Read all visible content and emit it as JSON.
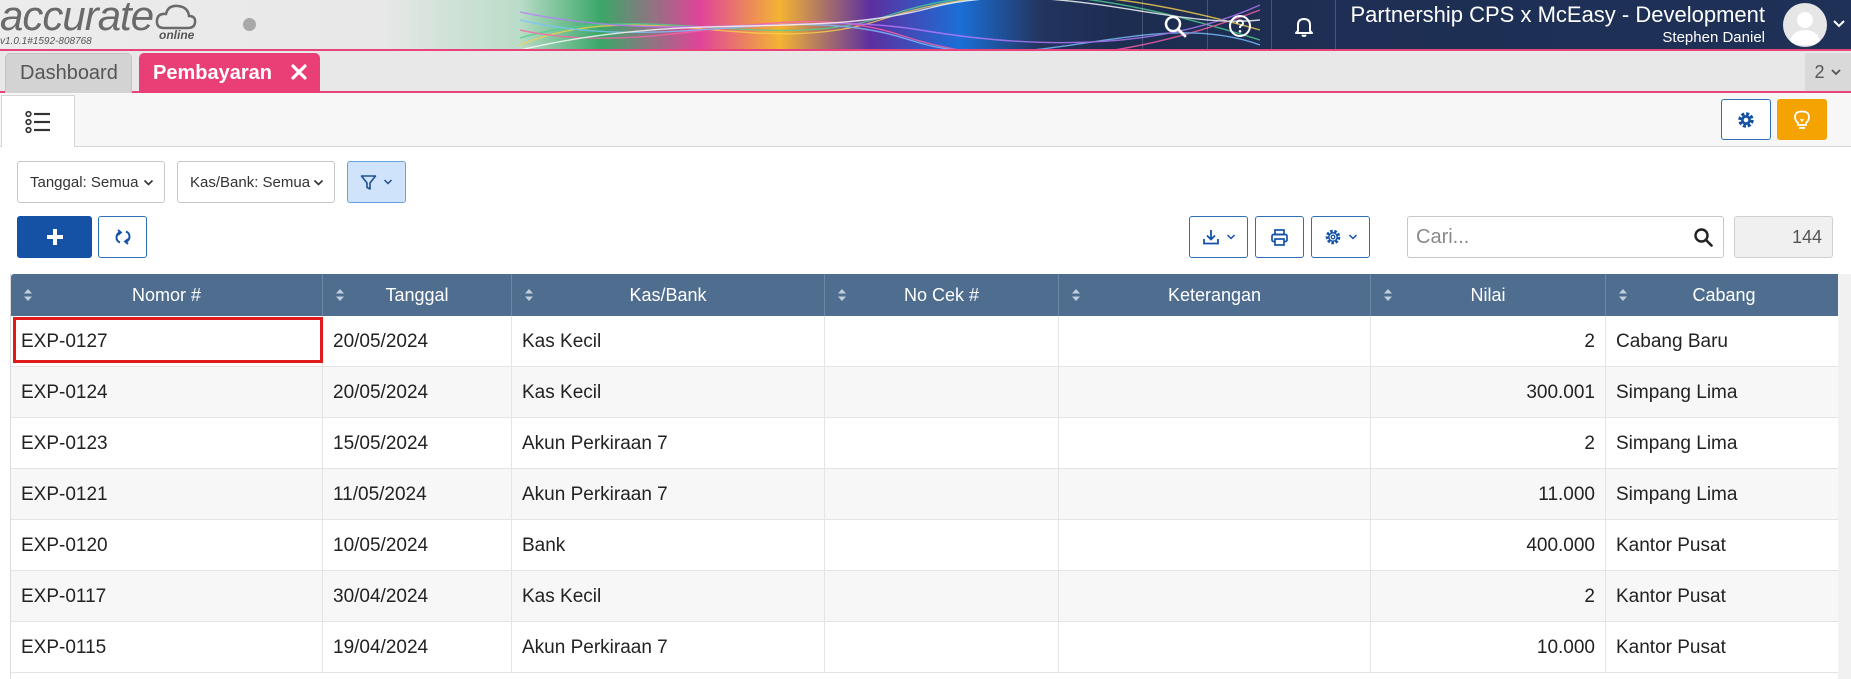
{
  "header": {
    "logo": "accurate",
    "logo_sub": "online",
    "version": "v1.0.1#1592-808768",
    "company": "Partnership CPS x McEasy - Development",
    "user": "Stephen Daniel"
  },
  "tabs": {
    "dashboard": "Dashboard",
    "active": "Pembayaran",
    "open_count": "2"
  },
  "filters": {
    "date": "Tanggal: Semua",
    "bank": "Kas/Bank: Semua"
  },
  "search": {
    "placeholder": "Cari...",
    "total": "144"
  },
  "table": {
    "columns": [
      "Nomor #",
      "Tanggal",
      "Kas/Bank",
      "No Cek #",
      "Keterangan",
      "Nilai",
      "Cabang"
    ],
    "rows": [
      [
        "EXP-0127",
        "20/05/2024",
        "Kas Kecil",
        "",
        "",
        "2",
        "Cabang Baru"
      ],
      [
        "EXP-0124",
        "20/05/2024",
        "Kas Kecil",
        "",
        "",
        "300.001",
        "Simpang Lima"
      ],
      [
        "EXP-0123",
        "15/05/2024",
        "Akun Perkiraan 7",
        "",
        "",
        "2",
        "Simpang Lima"
      ],
      [
        "EXP-0121",
        "11/05/2024",
        "Akun Perkiraan 7",
        "",
        "",
        "11.000",
        "Simpang Lima"
      ],
      [
        "EXP-0120",
        "10/05/2024",
        "Bank",
        "",
        "",
        "400.000",
        "Kantor Pusat"
      ],
      [
        "EXP-0117",
        "30/04/2024",
        "Kas Kecil",
        "",
        "",
        "2",
        "Kantor Pusat"
      ],
      [
        "EXP-0115",
        "19/04/2024",
        "Akun Perkiraan 7",
        "",
        "",
        "10.000",
        "Kantor Pusat"
      ]
    ]
  },
  "colors": {
    "accent": "#ea3e76",
    "primary": "#1552a6",
    "header_row": "#4f6d8f",
    "warning": "#f5a300",
    "highlight": "#e01b1b"
  },
  "icons": [
    "cloud-icon",
    "search-icon",
    "help-icon",
    "bell-icon",
    "avatar-icon",
    "chevron-down-icon",
    "close-icon",
    "list-icon",
    "gear-icon",
    "lightbulb-icon",
    "filter-icon",
    "plus-icon",
    "refresh-icon",
    "download-icon",
    "print-icon",
    "sort-icon"
  ]
}
